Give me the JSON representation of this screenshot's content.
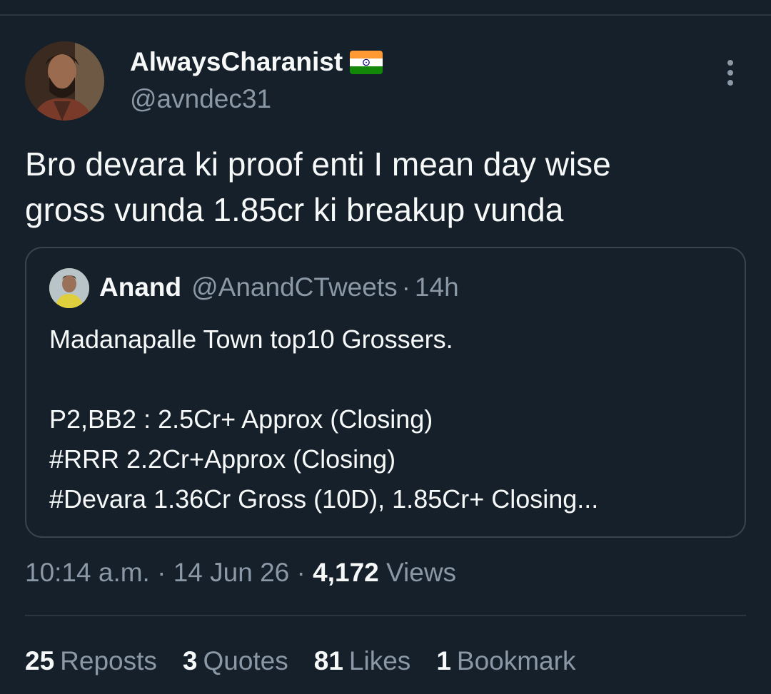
{
  "tweet": {
    "author": {
      "display_name": "AlwaysCharanist",
      "flag": "flag-india-icon",
      "handle": "@avndec31"
    },
    "text_lines": [
      "Bro devara ki proof enti I mean day wise",
      "gross vunda 1.85cr ki breakup vunda"
    ],
    "quoted": {
      "name": "Anand",
      "handle": "@AnandCTweets",
      "separator": "·",
      "time": "14h",
      "lines": [
        "Madanapalle Town top10 Grossers.",
        "",
        "P2,BB2 : 2.5Cr+ Approx (Closing)",
        "#RRR 2.2Cr+Approx (Closing)",
        "#Devara 1.36Cr Gross (10D), 1.85Cr+ Closing..."
      ]
    },
    "meta": {
      "time": "10:14 a.m.",
      "sep1": "·",
      "date": "14 Jun 26",
      "sep2": "·",
      "views_count": "4,172",
      "views_label": "Views"
    },
    "stats": {
      "reposts_count": "25",
      "reposts_label": "Reposts",
      "quotes_count": "3",
      "quotes_label": "Quotes",
      "likes_count": "81",
      "likes_label": "Likes",
      "bookmarks_count": "1",
      "bookmarks_label": "Bookmark"
    }
  },
  "colors": {
    "background": "#15202b",
    "text_primary": "#f7f9f9",
    "text_secondary": "#8b98a5",
    "border": "#38444d"
  }
}
